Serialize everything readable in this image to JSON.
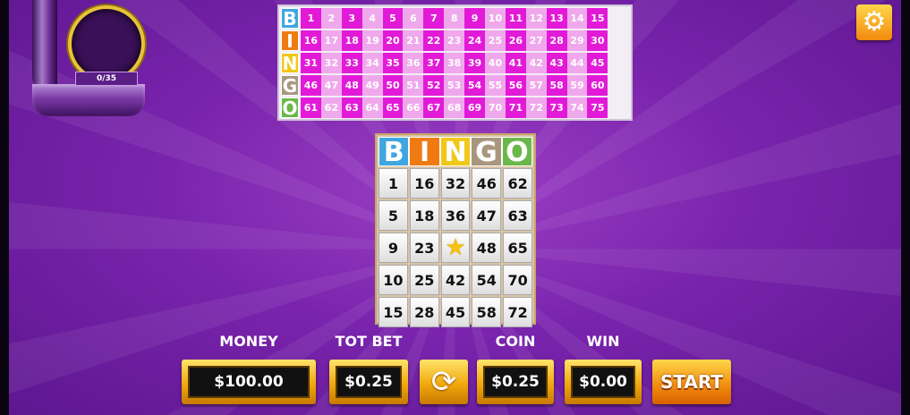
{
  "ball_counter": "0/35",
  "caller_board": {
    "letters": [
      {
        "char": "B",
        "color": "#3fa6e0"
      },
      {
        "char": "I",
        "color": "#f07a12"
      },
      {
        "char": "N",
        "color": "#f0c81a"
      },
      {
        "char": "G",
        "color": "#a8977e"
      },
      {
        "char": "O",
        "color": "#6ab84a"
      }
    ],
    "rows": [
      [
        "1",
        "2",
        "3",
        "4",
        "5",
        "6",
        "7",
        "8",
        "9",
        "10",
        "11",
        "12",
        "13",
        "14",
        "15"
      ],
      [
        "16",
        "17",
        "18",
        "19",
        "20",
        "21",
        "22",
        "23",
        "24",
        "25",
        "26",
        "27",
        "28",
        "29",
        "30"
      ],
      [
        "31",
        "32",
        "33",
        "34",
        "35",
        "36",
        "37",
        "38",
        "39",
        "40",
        "41",
        "42",
        "43",
        "44",
        "45"
      ],
      [
        "46",
        "47",
        "48",
        "49",
        "50",
        "51",
        "52",
        "53",
        "54",
        "55",
        "56",
        "57",
        "58",
        "59",
        "60"
      ],
      [
        "61",
        "62",
        "63",
        "64",
        "65",
        "66",
        "67",
        "68",
        "69",
        "70",
        "71",
        "72",
        "73",
        "74",
        "75"
      ]
    ],
    "on_color": "#e21ad8",
    "off_color": "#f0a8ec"
  },
  "card": {
    "header": [
      "B",
      "I",
      "N",
      "G",
      "O"
    ],
    "rows": [
      [
        "1",
        "16",
        "32",
        "46",
        "62"
      ],
      [
        "5",
        "18",
        "36",
        "47",
        "63"
      ],
      [
        "9",
        "23",
        "★",
        "48",
        "65"
      ],
      [
        "10",
        "25",
        "42",
        "54",
        "70"
      ],
      [
        "15",
        "28",
        "45",
        "58",
        "72"
      ]
    ],
    "free_space_icon": "star-icon"
  },
  "labels": {
    "money": "MONEY",
    "tot_bet": "TOT BET",
    "coin": "COIN",
    "win": "WIN"
  },
  "values": {
    "money": "$100.00",
    "tot_bet": "$0.25",
    "coin": "$0.25",
    "win": "$0.00"
  },
  "buttons": {
    "start": "START",
    "cycle_icon": "refresh-icon",
    "settings_icon": "gear-icon"
  }
}
